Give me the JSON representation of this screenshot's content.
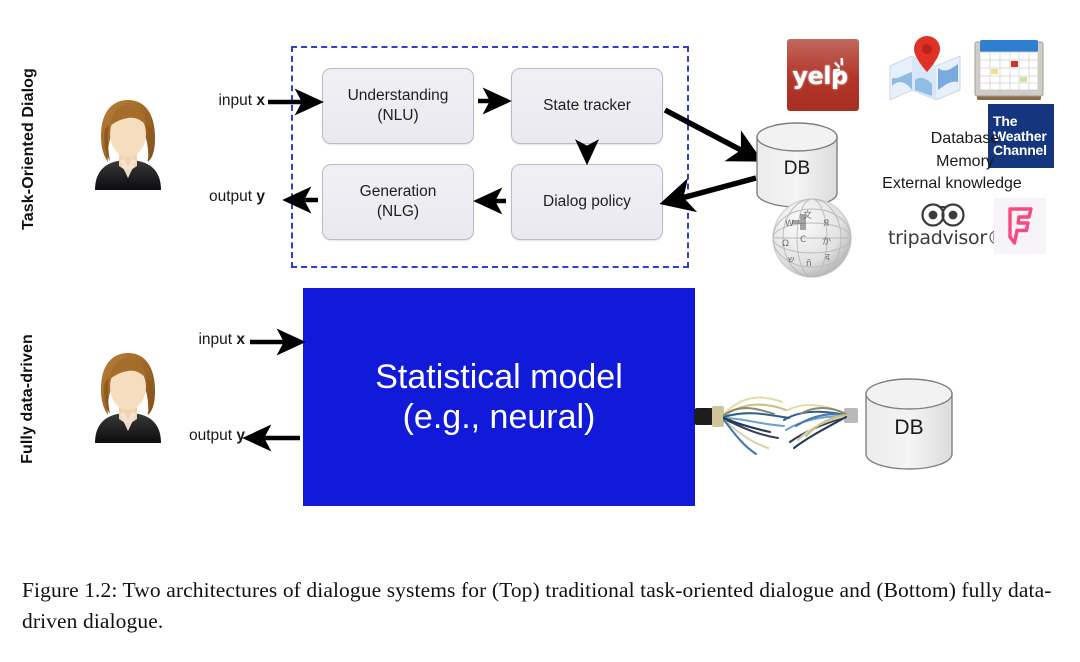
{
  "figure": {
    "rows": [
      {
        "id": "task-oriented",
        "label": "Task-Oriented Dialog"
      },
      {
        "id": "fully-data-driven",
        "label": "Fully data-driven"
      }
    ],
    "io": {
      "input_prefix": "input ",
      "input_var": "x",
      "output_prefix": "output ",
      "output_var": "y"
    },
    "pipeline": {
      "modules": [
        {
          "id": "nlu",
          "line1": "Understanding",
          "line2": "(NLU)"
        },
        {
          "id": "state-tracker",
          "line1": "State tracker",
          "line2": ""
        },
        {
          "id": "dialog-policy",
          "line1": "Dialog policy",
          "line2": ""
        },
        {
          "id": "nlg",
          "line1": "Generation",
          "line2": "(NLG)"
        }
      ],
      "dashed_border_color": "#2f3fd0"
    },
    "statistical_model": {
      "line1": "Statistical model",
      "line2": "(e.g., neural)",
      "fill_color": "#111ad8",
      "text_color": "#ffffff"
    },
    "database": {
      "top_label": "DB",
      "bottom_label": "DB"
    },
    "knowledge": {
      "lines": [
        "Database",
        "Memory",
        "External knowledge"
      ]
    },
    "logos": [
      {
        "id": "yelp",
        "name": "yelp-logo",
        "text": "yelp",
        "color": "#b3362a"
      },
      {
        "id": "maps",
        "name": "maps-icon",
        "text": "",
        "color": "#e03127"
      },
      {
        "id": "calendar",
        "name": "calendar-icon",
        "text": "",
        "color": "#3d7bd0"
      },
      {
        "id": "weather-channel",
        "name": "weather-channel-logo",
        "text": "The Weather Channel",
        "color": "#15357e"
      },
      {
        "id": "wikipedia",
        "name": "wikipedia-globe-icon",
        "text": "",
        "color": "#9a9a9a"
      },
      {
        "id": "tripadvisor",
        "name": "tripadvisor-logo",
        "text": "tripadvisor®",
        "color": "#3b3b3b"
      },
      {
        "id": "foursquare",
        "name": "foursquare-logo",
        "text": "",
        "color": "#f94877"
      }
    ],
    "weather_channel_lines": [
      "The",
      "Weather",
      "Channel"
    ],
    "tripadvisor_label": "tripadvisor®",
    "caption": "Figure 1.2: Two architectures of dialogue systems for (Top) traditional task-oriented dialogue and (Bottom) fully data-driven dialogue."
  }
}
